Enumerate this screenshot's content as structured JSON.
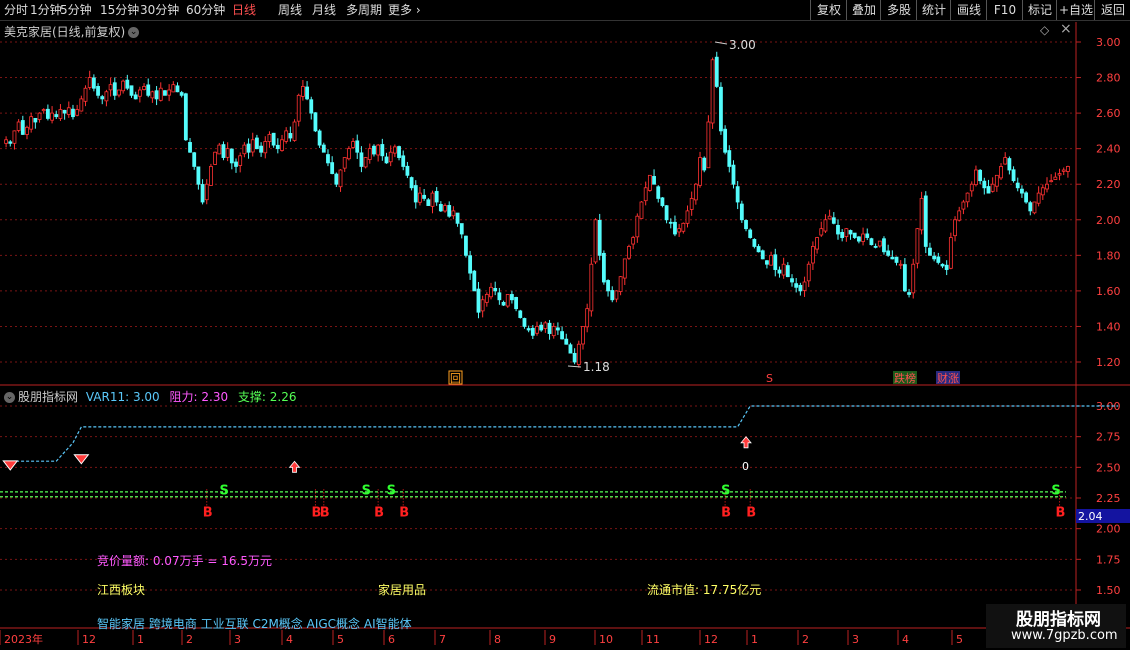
{
  "toolbar": {
    "timeframes": [
      "分时",
      "1分钟",
      "5分钟",
      "15分钟",
      "30分钟",
      "60分钟",
      "日线",
      "周线",
      "月线",
      "多周期",
      "更多"
    ],
    "active_index": 6,
    "more_arrow": "›",
    "right_buttons": [
      "复权",
      "叠加",
      "多股",
      "统计",
      "画线",
      "F10",
      "标记",
      "+自选",
      "返回"
    ]
  },
  "main": {
    "title": "美克家居(日线,前复权)",
    "dropdown_icon": "⌄",
    "diamond_icon": "◇",
    "close_icon": "×",
    "y_ticks": [
      "3.00",
      "2.80",
      "2.60",
      "2.40",
      "2.20",
      "2.00",
      "1.80",
      "1.60",
      "1.40",
      "1.20"
    ],
    "max_label": "3.00",
    "min_label": "1.18",
    "markers": [
      "回",
      "S",
      "跌榜",
      "财涨"
    ],
    "colors": {
      "up": "#ff3232",
      "down": "#54fcfc",
      "grid": "#7a1414"
    }
  },
  "indicator": {
    "name": "股朋指标网",
    "var_label": "VAR11: 3.00",
    "resistance_label": "阻力: 2.30",
    "support_label": "支撑: 2.26",
    "y_ticks": [
      "3.00",
      "2.75",
      "2.50",
      "2.25",
      "2.00",
      "1.75",
      "1.50"
    ],
    "current_value": "2.04",
    "b_label": "B",
    "s_label": "S",
    "zero_label": "0",
    "colors": {
      "var": "#5ac8fa",
      "resistance": "#ff5aff",
      "support": "#55ff55",
      "b": "#ff2020",
      "s": "#30ff30"
    }
  },
  "info": {
    "auction": "竞价量额: 0.07万手 = 16.5万元",
    "region": "江西板块",
    "industry": "家居用品",
    "market_cap": "流通市值: 17.75亿元",
    "concepts": "智能家居 跨境电商 工业互联 C2M概念 AIGC概念 AI智能体"
  },
  "x_axis": {
    "labels": [
      "2023年",
      "12",
      "1",
      "2",
      "3",
      "4",
      "5",
      "6",
      "7",
      "8",
      "9",
      "10",
      "11",
      "12",
      "1",
      "2",
      "3",
      "4",
      "5"
    ]
  },
  "chart_data": {
    "type": "candlestick",
    "y_range_main": [
      1.12,
      3.08
    ],
    "y_range_indicator": [
      1.4,
      3.12
    ],
    "closes": [
      2.45,
      2.43,
      2.5,
      2.55,
      2.48,
      2.52,
      2.58,
      2.55,
      2.6,
      2.62,
      2.57,
      2.6,
      2.58,
      2.62,
      2.6,
      2.63,
      2.58,
      2.62,
      2.68,
      2.74,
      2.8,
      2.74,
      2.7,
      2.68,
      2.72,
      2.76,
      2.7,
      2.73,
      2.78,
      2.74,
      2.7,
      2.68,
      2.73,
      2.75,
      2.7,
      2.72,
      2.68,
      2.74,
      2.7,
      2.73,
      2.76,
      2.72,
      2.7,
      2.45,
      2.38,
      2.3,
      2.2,
      2.1,
      2.2,
      2.3,
      2.38,
      2.42,
      2.35,
      2.4,
      2.32,
      2.3,
      2.36,
      2.42,
      2.38,
      2.45,
      2.4,
      2.38,
      2.44,
      2.48,
      2.42,
      2.4,
      2.45,
      2.5,
      2.46,
      2.55,
      2.7,
      2.75,
      2.68,
      2.6,
      2.5,
      2.42,
      2.38,
      2.32,
      2.26,
      2.2,
      2.28,
      2.35,
      2.4,
      2.44,
      2.38,
      2.3,
      2.35,
      2.4,
      2.37,
      2.42,
      2.36,
      2.32,
      2.38,
      2.41,
      2.35,
      2.3,
      2.25,
      2.18,
      2.1,
      2.15,
      2.12,
      2.08,
      2.15,
      2.1,
      2.05,
      2.08,
      2.02,
      2.05,
      1.98,
      1.92,
      1.8,
      1.7,
      1.6,
      1.48,
      1.55,
      1.58,
      1.62,
      1.6,
      1.55,
      1.52,
      1.58,
      1.55,
      1.5,
      1.45,
      1.4,
      1.38,
      1.35,
      1.4,
      1.38,
      1.42,
      1.36,
      1.4,
      1.38,
      1.33,
      1.3,
      1.25,
      1.2,
      1.3,
      1.4,
      1.5,
      1.75,
      2.0,
      1.8,
      1.65,
      1.6,
      1.55,
      1.6,
      1.68,
      1.78,
      1.85,
      1.9,
      2.02,
      2.1,
      2.18,
      2.25,
      2.2,
      2.12,
      2.08,
      2.0,
      1.98,
      1.92,
      1.95,
      1.98,
      2.05,
      2.12,
      2.2,
      2.35,
      2.28,
      2.55,
      2.9,
      2.75,
      2.5,
      2.38,
      2.3,
      2.2,
      2.1,
      2.0,
      1.95,
      1.9,
      1.85,
      1.82,
      1.78,
      1.75,
      1.8,
      1.72,
      1.7,
      1.75,
      1.68,
      1.65,
      1.62,
      1.6,
      1.65,
      1.75,
      1.85,
      1.9,
      1.95,
      2.0,
      2.02,
      1.98,
      1.92,
      1.9,
      1.95,
      1.92,
      1.9,
      1.88,
      1.92,
      1.9,
      1.86,
      1.85,
      1.88,
      1.82,
      1.8,
      1.78,
      1.76,
      1.75,
      1.6,
      1.58,
      1.75,
      1.95,
      2.12,
      1.85,
      1.8,
      1.78,
      1.76,
      1.74,
      1.72,
      1.9,
      2.0,
      2.05,
      2.1,
      2.15,
      2.2,
      2.28,
      2.22,
      2.18,
      2.15,
      2.2,
      2.25,
      2.3,
      2.35,
      2.28,
      2.22,
      2.18,
      2.15,
      2.1,
      2.05,
      2.1,
      2.15,
      2.18,
      2.2,
      2.22,
      2.24,
      2.26,
      2.28,
      2.3
    ],
    "var11": [
      {
        "i": 0,
        "v": 2.55
      },
      {
        "i": 12,
        "v": 2.55
      },
      {
        "i": 16,
        "v": 2.7
      },
      {
        "i": 18,
        "v": 2.83
      },
      {
        "i": 175,
        "v": 2.83
      },
      {
        "i": 178,
        "v": 3.0
      },
      {
        "i": 266,
        "v": 3.0
      }
    ],
    "resistance": 2.3,
    "support": 2.26,
    "b_signals": [
      48,
      74,
      76,
      89,
      95,
      172,
      178,
      252
    ],
    "s_signals": [
      52,
      86,
      92,
      172,
      251
    ],
    "highlights": [
      {
        "i": 1,
        "v": 2.52
      },
      {
        "i": 18,
        "v": 2.57
      },
      {
        "i": 69,
        "v": 2.5
      },
      {
        "i": 177,
        "v": 2.7
      }
    ]
  }
}
